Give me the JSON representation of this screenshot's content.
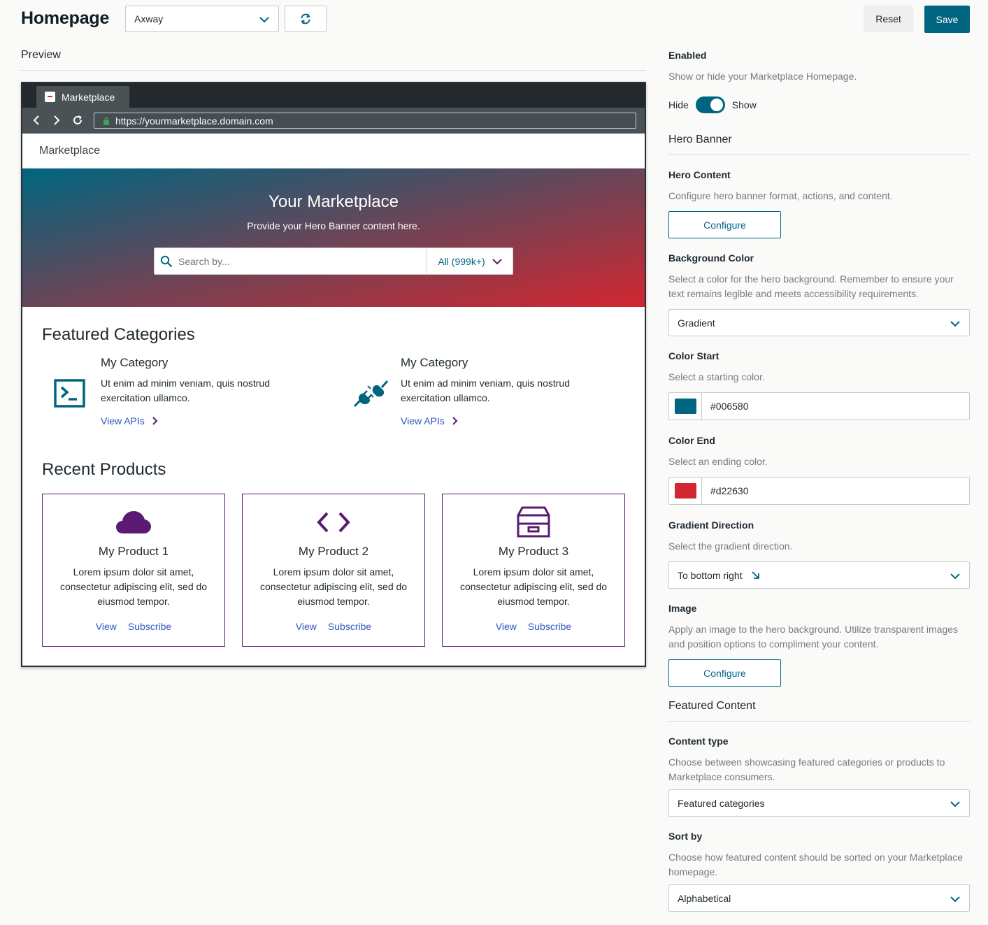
{
  "header": {
    "title": "Homepage",
    "org_select_value": "Axway",
    "refresh_icon": "refresh-icon",
    "reset_label": "Reset",
    "save_label": "Save"
  },
  "preview": {
    "label": "Preview",
    "browser": {
      "tab_label": "Marketplace",
      "url": "https://yourmarketplace.domain.com"
    },
    "site": {
      "header_title": "Marketplace",
      "hero": {
        "title": "Your Marketplace",
        "subtitle": "Provide your Hero Banner content here.",
        "search_placeholder": "Search by...",
        "search_filter": "All (999k+)"
      },
      "featured_categories": {
        "title": "Featured Categories",
        "items": [
          {
            "title": "My Category",
            "description": "Ut enim ad minim veniam, quis nostrud exercitation ullamco.",
            "link": "View APIs",
            "icon": "terminal-icon"
          },
          {
            "title": "My Category",
            "description": "Ut enim ad minim veniam, quis nostrud exercitation ullamco.",
            "link": "View APIs",
            "icon": "plug-icon"
          }
        ]
      },
      "recent_products": {
        "title": "Recent Products",
        "items": [
          {
            "title": "My Product 1",
            "description": "Lorem ipsum dolor sit amet, consectetur adipiscing elit, sed do eiusmod tempor.",
            "view": "View",
            "subscribe": "Subscribe",
            "icon": "cloud-icon"
          },
          {
            "title": "My Product 2",
            "description": "Lorem ipsum dolor sit amet, consectetur adipiscing elit, sed do eiusmod tempor.",
            "view": "View",
            "subscribe": "Subscribe",
            "icon": "code-icon"
          },
          {
            "title": "My Product 3",
            "description": "Lorem ipsum dolor sit amet, consectetur adipiscing elit, sed do eiusmod tempor.",
            "view": "View",
            "subscribe": "Subscribe",
            "icon": "archive-icon"
          }
        ]
      }
    }
  },
  "settings": {
    "enabled": {
      "label": "Enabled",
      "help": "Show or hide your Marketplace Homepage.",
      "off_label": "Hide",
      "on_label": "Show",
      "value": true
    },
    "hero_banner": {
      "section_title": "Hero Banner",
      "hero_content": {
        "label": "Hero Content",
        "help": "Configure hero banner format, actions, and content.",
        "button": "Configure"
      },
      "background_color": {
        "label": "Background Color",
        "help": "Select a color for the hero background. Remember to ensure your text remains legible and meets accessibility requirements.",
        "value": "Gradient"
      },
      "color_start": {
        "label": "Color Start",
        "help": "Select a starting color.",
        "value": "#006580"
      },
      "color_end": {
        "label": "Color End",
        "help": "Select an ending color.",
        "value": "#d22630"
      },
      "gradient_direction": {
        "label": "Gradient Direction",
        "help": "Select the gradient direction.",
        "value": "To bottom right",
        "icon": "arrow-down-right-icon"
      },
      "image": {
        "label": "Image",
        "help": "Apply an image to the hero background. Utilize transparent images and position options to compliment your content.",
        "button": "Configure"
      }
    },
    "featured_content": {
      "section_title": "Featured Content",
      "content_type": {
        "label": "Content type",
        "help": "Choose between showcasing featured categories or products to Marketplace consumers.",
        "value": "Featured categories"
      },
      "sort_by": {
        "label": "Sort by",
        "help": "Choose how featured content should be sorted on your Marketplace homepage.",
        "value": "Alphabetical"
      }
    }
  },
  "colors": {
    "brand": "#006580",
    "accent_red": "#d22630",
    "product_purple": "#5a1a71",
    "link_blue": "#2f55c0"
  }
}
